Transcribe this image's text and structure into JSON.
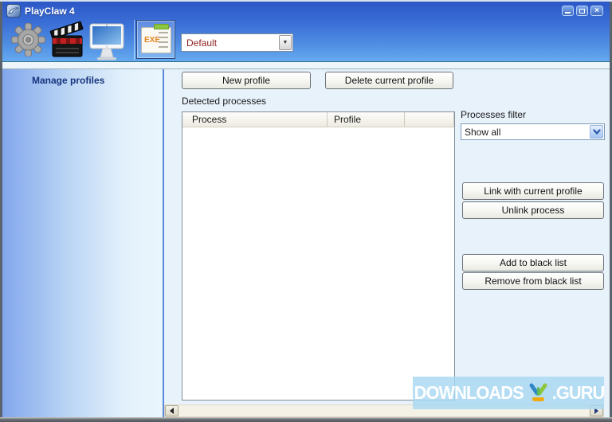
{
  "titlebar": {
    "title": "PlayClaw 4"
  },
  "toolbar": {
    "exe_icon_label": "EXE",
    "profile_dropdown_value": "Default"
  },
  "sidebar": {
    "active_item": "Manage profiles"
  },
  "profiles": {
    "new_button": "New profile",
    "delete_button": "Delete current profile",
    "detected_label": "Detected processes",
    "columns": {
      "process": "Process",
      "profile": "Profile"
    },
    "rows": [],
    "filter_label": "Processes filter",
    "filter_value": "Show all",
    "link_button": "Link with current profile",
    "unlink_button": "Unlink process",
    "add_blacklist_button": "Add to black list",
    "remove_blacklist_button": "Remove from black list"
  },
  "watermark": {
    "prefix": "DOWNLOADS",
    "suffix": ".GURU"
  },
  "icons": {
    "dropdown_arrow": "▼",
    "close": "×"
  },
  "colors": {
    "header_blue_top": "#2c57c6",
    "header_blue_bottom": "#66aaf0",
    "sidebar_text": "#17357e",
    "default_profile_text": "#8b1f1f",
    "watermark_band": "#a8d8f2"
  }
}
